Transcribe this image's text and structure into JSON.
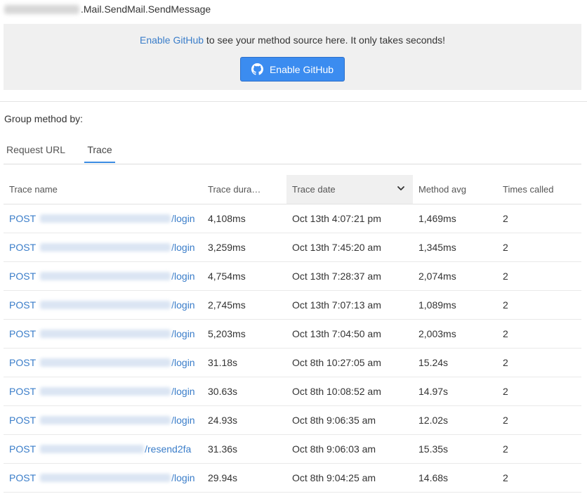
{
  "method": {
    "name": ".Mail.SendMail.SendMessage"
  },
  "banner": {
    "link_text": "Enable GitHub",
    "message": " to see your method source here. It only takes seconds!",
    "button_label": "Enable GitHub"
  },
  "group_by": {
    "label": "Group method by:",
    "tabs": [
      "Request URL",
      "Trace"
    ],
    "active_tab": "Trace"
  },
  "table": {
    "columns": [
      "Trace name",
      "Trace dura…",
      "Trace date",
      "Method avg",
      "Times called"
    ],
    "sorted_column": "Trace date",
    "rows": [
      {
        "method": "POST",
        "path": "/login",
        "duration": "4,108ms",
        "date": "Oct 13th 4:07:21 pm",
        "avg": "1,469ms",
        "times": "2"
      },
      {
        "method": "POST",
        "path": "/login",
        "duration": "3,259ms",
        "date": "Oct 13th 7:45:20 am",
        "avg": "1,345ms",
        "times": "2"
      },
      {
        "method": "POST",
        "path": "/login",
        "duration": "4,754ms",
        "date": "Oct 13th 7:28:37 am",
        "avg": "2,074ms",
        "times": "2"
      },
      {
        "method": "POST",
        "path": "/login",
        "duration": "2,745ms",
        "date": "Oct 13th 7:07:13 am",
        "avg": "1,089ms",
        "times": "2"
      },
      {
        "method": "POST",
        "path": "/login",
        "duration": "5,203ms",
        "date": "Oct 13th 7:04:50 am",
        "avg": "2,003ms",
        "times": "2"
      },
      {
        "method": "POST",
        "path": "/login",
        "duration": "31.18s",
        "date": "Oct 8th 10:27:05 am",
        "avg": "15.24s",
        "times": "2"
      },
      {
        "method": "POST",
        "path": "/login",
        "duration": "30.63s",
        "date": "Oct 8th 10:08:52 am",
        "avg": "14.97s",
        "times": "2"
      },
      {
        "method": "POST",
        "path": "/login",
        "duration": "24.93s",
        "date": "Oct 8th 9:06:35 am",
        "avg": "12.02s",
        "times": "2"
      },
      {
        "method": "POST",
        "path": "/resend2fa",
        "duration": "31.36s",
        "date": "Oct 8th 9:06:03 am",
        "avg": "15.35s",
        "times": "2"
      },
      {
        "method": "POST",
        "path": "/login",
        "duration": "29.94s",
        "date": "Oct 8th 9:04:25 am",
        "avg": "14.68s",
        "times": "2"
      }
    ]
  },
  "colors": {
    "link": "#3a7dc9",
    "button_bg": "#3b8cf0",
    "banner_bg": "#f0f0f0",
    "active_tab_underline": "#3b8ce2"
  },
  "icons": {
    "button_icon": "github-icon",
    "sort_icon": "chevron-down-icon"
  }
}
